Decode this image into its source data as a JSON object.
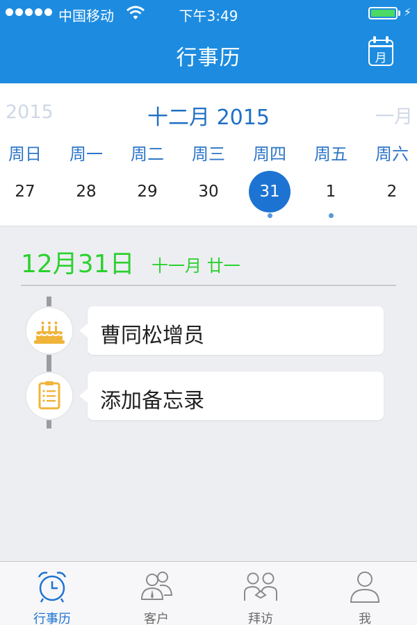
{
  "status_bar": {
    "carrier": "中国移动",
    "time": "下午3:49",
    "battery_level": 1.0
  },
  "nav": {
    "title": "行事历",
    "month_button_label": "月"
  },
  "calendar": {
    "prev_month": "2015",
    "current_month": "十二月 2015",
    "next_month": "一月",
    "weekdays": [
      "周日",
      "周一",
      "周二",
      "周三",
      "周四",
      "周五",
      "周六"
    ],
    "days": [
      {
        "num": "27",
        "selected": false,
        "has_event": false
      },
      {
        "num": "28",
        "selected": false,
        "has_event": false
      },
      {
        "num": "29",
        "selected": false,
        "has_event": false
      },
      {
        "num": "30",
        "selected": false,
        "has_event": false
      },
      {
        "num": "31",
        "selected": true,
        "has_event": true
      },
      {
        "num": "1",
        "selected": false,
        "has_event": true
      },
      {
        "num": "2",
        "selected": false,
        "has_event": false
      }
    ]
  },
  "agenda": {
    "date": "12月31日",
    "lunar_date": "十一月 廿一",
    "events": [
      {
        "icon": "birthday-cake-icon",
        "label": "曹同松增员"
      },
      {
        "icon": "memo-note-icon",
        "label": "添加备忘录"
      }
    ]
  },
  "tabbar": {
    "tabs": [
      {
        "label": "行事历",
        "icon": "alarm-clock-icon",
        "active": true
      },
      {
        "label": "客户",
        "icon": "customers-icon",
        "active": false
      },
      {
        "label": "拜访",
        "icon": "visit-handshake-icon",
        "active": false
      },
      {
        "label": "我",
        "icon": "profile-icon",
        "active": false
      }
    ]
  },
  "colors": {
    "header_bg": "#1d8ce0",
    "accent_blue": "#1d73d2",
    "green_date": "#2bd12f",
    "icon_orange": "#f0b43a"
  }
}
